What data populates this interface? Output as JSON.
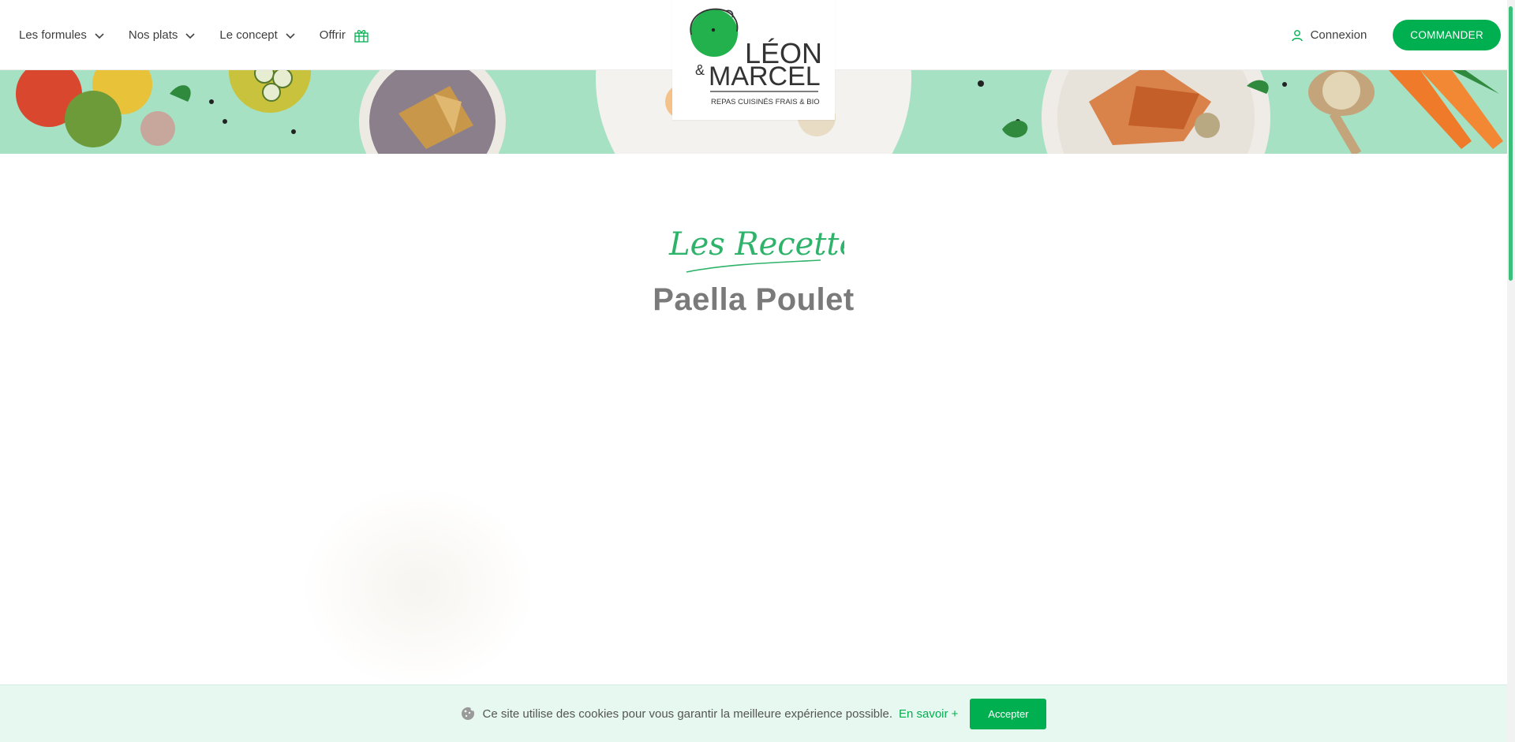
{
  "nav": {
    "items": [
      {
        "label": "Les formules",
        "icon": "chevron-down-icon"
      },
      {
        "label": "Nos plats",
        "icon": "chevron-down-icon"
      },
      {
        "label": "Le concept",
        "icon": "chevron-down-icon"
      },
      {
        "label": "Offrir",
        "icon": "gift-icon"
      }
    ]
  },
  "logo": {
    "line1": "LÉON",
    "line2": "MARCEL",
    "ampersand": "&",
    "tagline": "REPAS CUISINÉS FRAIS & BIO"
  },
  "header_right": {
    "login_label": "Connexion",
    "cta_label": "COMMANDER"
  },
  "section": {
    "script_title": "Les Recettes",
    "recipe_title": "Paella Poulet"
  },
  "cookie": {
    "text": "Ce site utilise des cookies pour vous garantir la meilleure expérience possible.",
    "link": "En savoir +",
    "button": "Accepter"
  },
  "colors": {
    "brand_green": "#00b050",
    "banner_mint": "#a6e1c4",
    "cookie_bg": "#e6f8ef"
  }
}
